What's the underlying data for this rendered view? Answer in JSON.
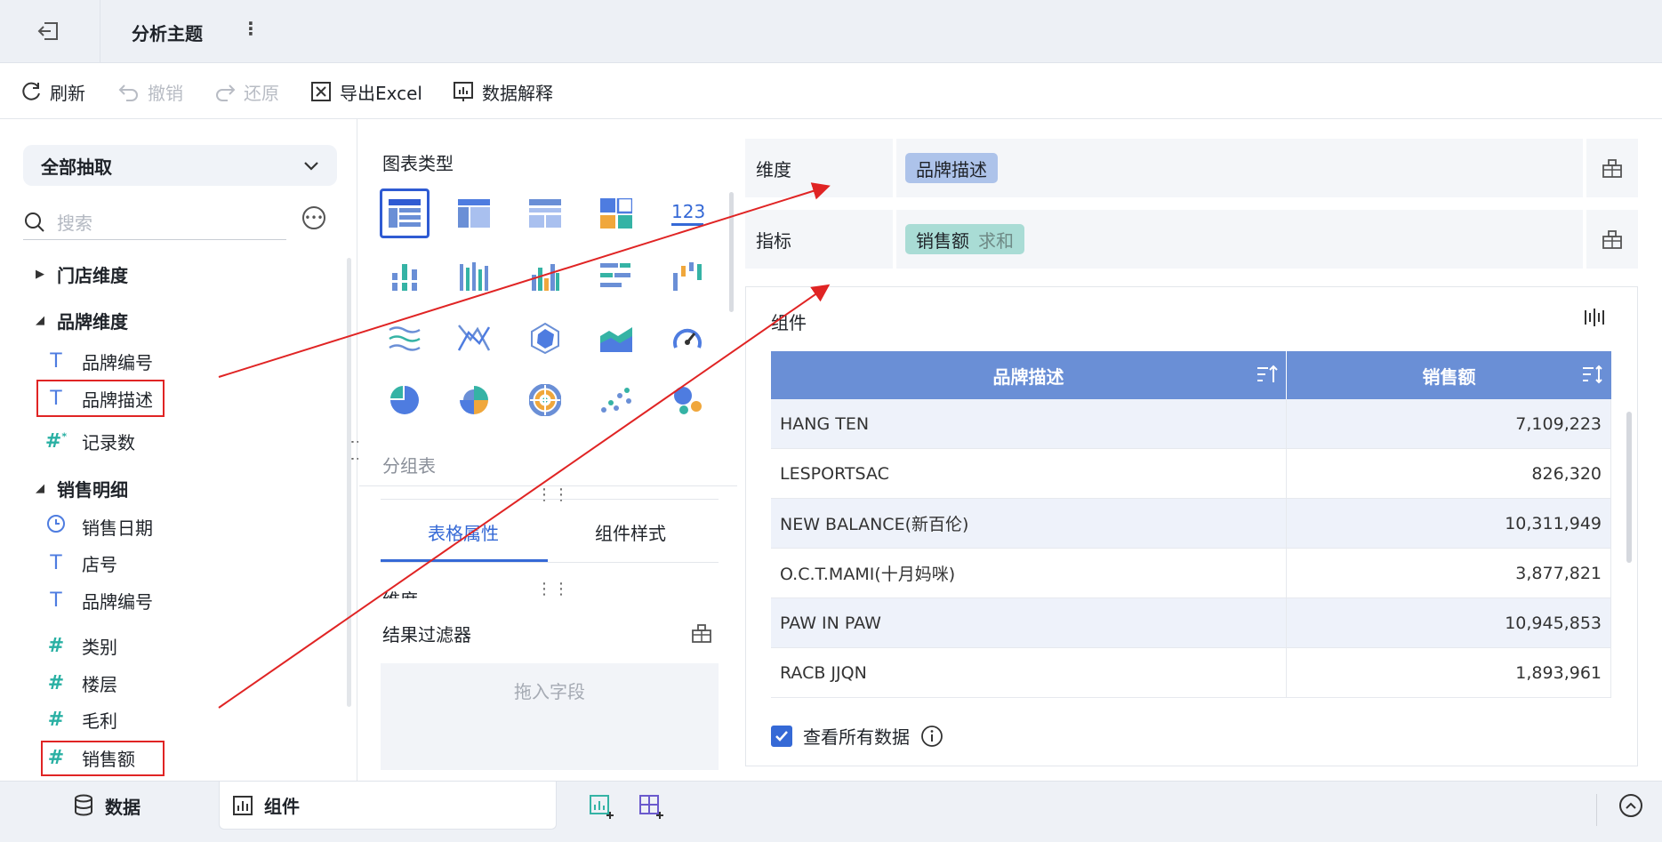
{
  "titlebar": {
    "title": "分析主题",
    "more": "⋮"
  },
  "toolbar": {
    "refresh": "刷新",
    "undo": "撤销",
    "redo": "还原",
    "export": "导出Excel",
    "explain": "数据解释"
  },
  "left": {
    "select_value": "全部抽取",
    "search_placeholder": "搜索",
    "groups": [
      {
        "label": "门店维度",
        "expanded": false
      },
      {
        "label": "品牌维度",
        "expanded": true
      },
      {
        "label": "销售明细",
        "expanded": true
      }
    ],
    "brand_fields": [
      {
        "label": "品牌编号",
        "icon": "text-type-icon"
      },
      {
        "label": "品牌描述",
        "icon": "text-type-icon"
      }
    ],
    "record_count": "记录数",
    "sales_fields": [
      {
        "label": "销售日期",
        "icon": "date-type-icon"
      },
      {
        "label": "店号",
        "icon": "text-type-icon"
      },
      {
        "label": "品牌编号",
        "icon": "text-type-icon"
      },
      {
        "label": "类别",
        "icon": "number-type-icon"
      },
      {
        "label": "楼层",
        "icon": "number-type-icon"
      },
      {
        "label": "毛利",
        "icon": "number-type-icon"
      },
      {
        "label": "销售额",
        "icon": "number-type-icon"
      }
    ]
  },
  "middle": {
    "chart_type_title": "图表类型",
    "selected_chart_label": "分组表",
    "tab_table": "表格属性",
    "tab_style": "组件样式",
    "partial_label": "维度",
    "filter_title": "结果过滤器",
    "drop_placeholder": "拖入字段"
  },
  "right": {
    "dimension_label": "维度",
    "dimension_pill": "品牌描述",
    "measure_label": "指标",
    "measure_pill": "销售额",
    "measure_agg": "求和",
    "component_title": "组件",
    "table": {
      "headers": [
        "品牌描述",
        "销售额"
      ],
      "rows": [
        [
          "HANG TEN",
          "7,109,223"
        ],
        [
          "LESPORTSAC",
          "826,320"
        ],
        [
          "NEW BALANCE(新百伦)",
          "10,311,949"
        ],
        [
          "O.C.T.MAMI(十月妈咪)",
          "3,877,821"
        ],
        [
          "PAW IN PAW",
          "10,945,853"
        ],
        [
          "RACB JJQN",
          "1,893,961"
        ]
      ]
    },
    "view_all_label": "查看所有数据",
    "view_all_checked": true
  },
  "bottom": {
    "data_tab": "数据",
    "component_tab": "组件"
  },
  "colors": {
    "accent": "#3569d6",
    "table_header": "#6a8fd6",
    "dimension_pill": "#adc3ea",
    "measure_pill": "#a9dcd5",
    "annotation_red": "#e02424"
  }
}
